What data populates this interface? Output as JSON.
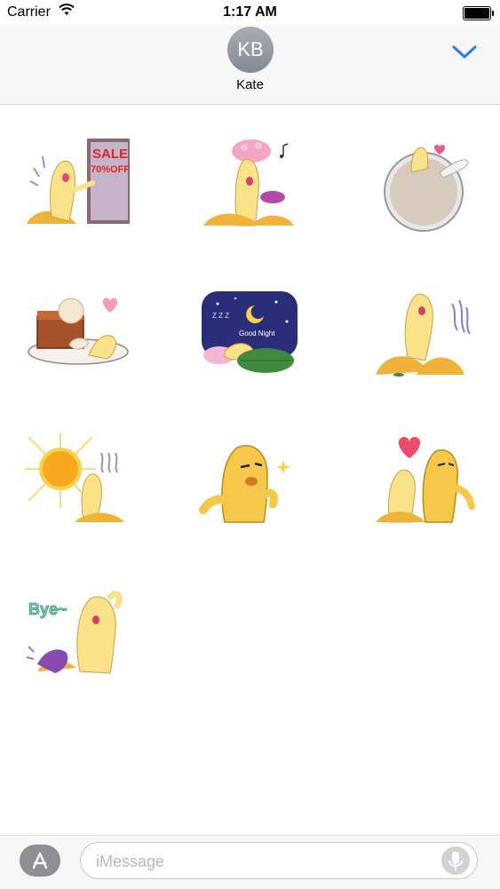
{
  "status_bar": {
    "carrier": "Carrier",
    "time": "1:17 AM"
  },
  "header": {
    "avatar_initials": "KB",
    "contact_name": "Kate",
    "accent_color": "#1f7ef0"
  },
  "stickers": {
    "sale": {
      "sign_line1": "SALE",
      "sign_line2": "70%OFF"
    },
    "good_night": {
      "text": "Good Night"
    },
    "bye": {
      "text": "Bye~"
    }
  },
  "composer": {
    "placeholder": "iMessage"
  },
  "icons": [
    "wifi-icon",
    "battery-icon",
    "chevron-down-icon",
    "app-store-icon",
    "microphone-icon"
  ]
}
